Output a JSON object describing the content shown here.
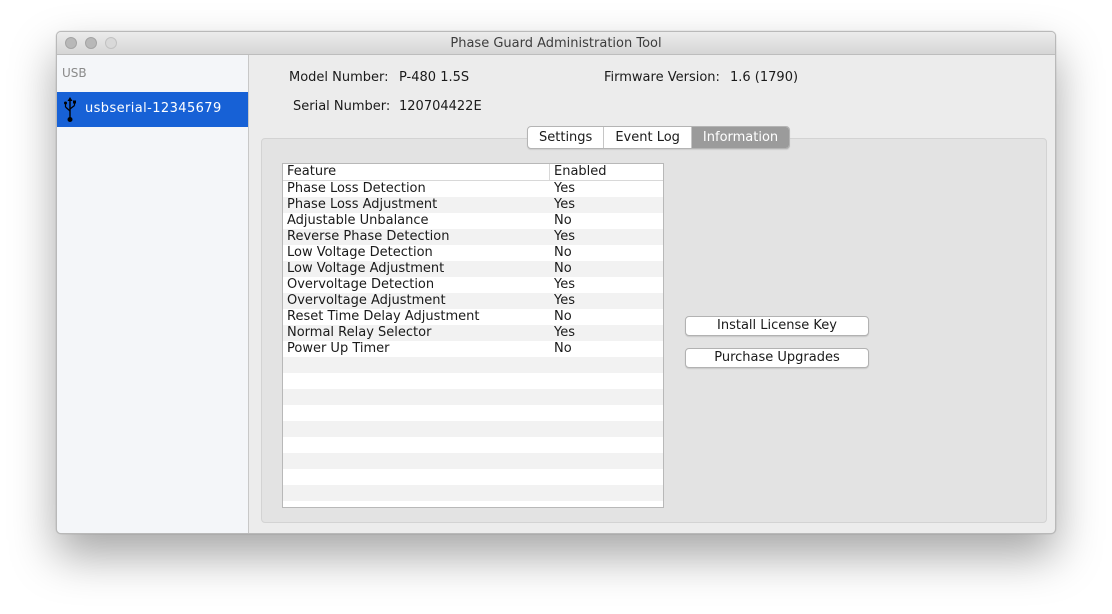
{
  "window": {
    "title": "Phase Guard Administration Tool"
  },
  "sidebar": {
    "group_label": "USB",
    "device": {
      "icon": "usb-icon",
      "label": "usbserial-12345679"
    }
  },
  "device_info": {
    "model_label": "Model Number:",
    "model_value": "P-480 1.5S",
    "firmware_label": "Firmware Version:",
    "firmware_value": "1.6 (1790)",
    "serial_label": "Serial Number:",
    "serial_value": "120704422E"
  },
  "tabs": [
    {
      "label": "Settings",
      "active": false
    },
    {
      "label": "Event Log",
      "active": false
    },
    {
      "label": "Information",
      "active": true
    }
  ],
  "features_table": {
    "columns": [
      "Feature",
      "Enabled"
    ],
    "rows": [
      [
        "Phase Loss Detection",
        "Yes"
      ],
      [
        "Phase Loss Adjustment",
        "Yes"
      ],
      [
        "Adjustable Unbalance",
        "No"
      ],
      [
        "Reverse Phase Detection",
        "Yes"
      ],
      [
        "Low Voltage Detection",
        "No"
      ],
      [
        "Low Voltage Adjustment",
        "No"
      ],
      [
        "Overvoltage Detection",
        "Yes"
      ],
      [
        "Overvoltage Adjustment",
        "Yes"
      ],
      [
        "Reset Time Delay Adjustment",
        "No"
      ],
      [
        "Normal Relay Selector",
        "Yes"
      ],
      [
        "Power Up Timer",
        "No"
      ]
    ]
  },
  "buttons": {
    "install_license": "Install License Key",
    "purchase_upgrades": "Purchase Upgrades"
  },
  "colors": {
    "selection": "#1761d6",
    "active_tab": "#9b9b9b",
    "window_bg": "#ececec"
  }
}
